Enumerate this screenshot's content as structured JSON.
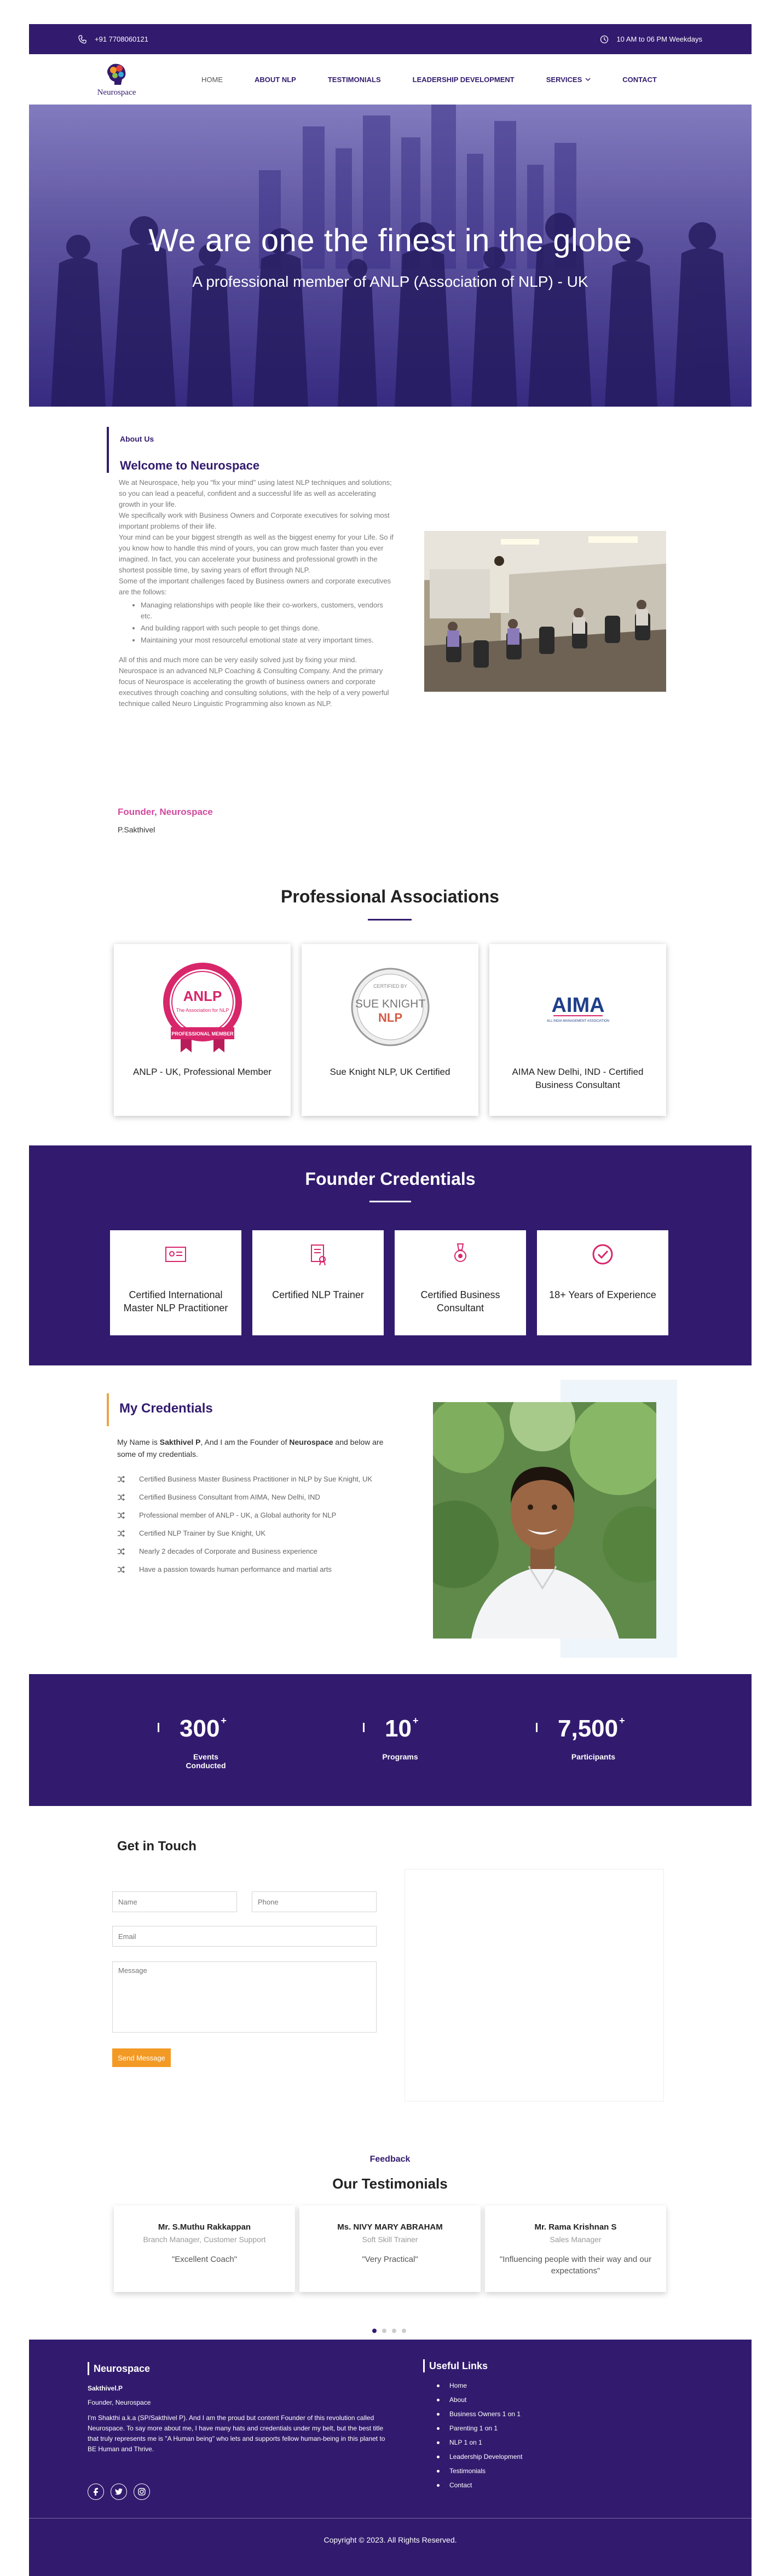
{
  "topbar": {
    "phone": "+91 7708060121",
    "hours": "10 AM to 06 PM Weekdays"
  },
  "brand": {
    "name": "Neurospace"
  },
  "nav": [
    {
      "label": "HOME"
    },
    {
      "label": "ABOUT NLP"
    },
    {
      "label": "TESTIMONIALS"
    },
    {
      "label": "LEADERSHIP DEVELOPMENT"
    },
    {
      "label": "SERVICES"
    },
    {
      "label": "CONTACT"
    }
  ],
  "hero": {
    "title": "We are one the finest in the globe",
    "subtitle": "A professional member of ANLP (Association of NLP) - UK"
  },
  "about": {
    "kicker": "About Us",
    "title": "Welcome to Neurospace",
    "p1": "We at Neurospace, help you \"fix your mind\" using latest NLP techniques and solutions; so you can lead a peaceful, confident and a successful life as well as accelerating growth in your life.",
    "p2": "We specifically work with Business Owners and Corporate executives for solving most important problems of their life.",
    "p3": "Your mind can be your biggest strength as well as the biggest enemy for your Life. So if you know how to handle this mind of yours, you can grow much faster than you ever imagined. In fact, you can accelerate your business and professional growth in the shortest possible time, by saving years of effort through NLP.",
    "p4": "Some of the important challenges faced by Business owners and corporate executives are the follows:",
    "bullets": [
      "Managing relationships with people like their co-workers, customers, vendors etc.",
      "And building rapport with such people to get things done.",
      "Maintaining your most resourceful emotional state at very important times."
    ],
    "p5": "All of this and much more can be very easily solved just by fixing your mind. Neurospace is an advanced NLP Coaching & Consulting Company. And the primary focus of Neurospace is accelerating the growth of business owners and corporate executives through coaching and consulting solutions, with the help of a very powerful technique called Neuro Linguistic Programming also known as NLP.",
    "founder_label": "Founder, Neurospace",
    "founder_name": "P.Sakthivel"
  },
  "associations": {
    "title": "Professional Associations",
    "badge_anlp": {
      "top": "ANLP",
      "mid": "The Association for NLP",
      "ribbon": "PROFESSIONAL MEMBER"
    },
    "badge_sue": {
      "line1": "SUE KNIGHT",
      "line2": "NLP",
      "ring": "CERTIFIED BY"
    },
    "badge_aima": {
      "line1": "AIMA",
      "line2": "ALL INDIA MANAGEMENT ASSOCIATION"
    },
    "cards": [
      {
        "label": "ANLP - UK, Professional Member"
      },
      {
        "label": "Sue Knight NLP, UK Certified"
      },
      {
        "label": "AIMA New Delhi, IND - Certified Business Consultant"
      }
    ]
  },
  "credentials": {
    "title": "Founder Credentials",
    "cards": [
      {
        "label": "Certified International Master NLP Practitioner",
        "icon": "certificate-icon"
      },
      {
        "label": "Certified NLP Trainer",
        "icon": "diploma-icon"
      },
      {
        "label": "Certified Business Consultant",
        "icon": "award-icon"
      },
      {
        "label": "18+ Years of Experience",
        "icon": "check-circle-icon"
      }
    ]
  },
  "my_credentials": {
    "title": "My Credentials",
    "intro_pre": "My Name is ",
    "intro_name": "Sakthivel P",
    "intro_mid": ", And I am the Founder of ",
    "intro_brand": "Neurospace",
    "intro_post": " and below are some of my credentials.",
    "items": [
      "Certified Business Master Business Practitioner in NLP by Sue Knight, UK",
      "Certified Business Consultant from AIMA, New Delhi, IND",
      "Professional member of ANLP - UK, a Global authority for NLP",
      "Certified NLP Trainer by Sue Knight, UK",
      "Nearly 2 decades of Corporate and Business experience",
      "Have a passion towards human performance and martial arts"
    ]
  },
  "stats": [
    {
      "value": "300",
      "suffix": "+",
      "label": "Events Conducted"
    },
    {
      "value": "10",
      "suffix": "+",
      "label": "Programs"
    },
    {
      "value": "7,500",
      "suffix": "+",
      "label": "Participants"
    }
  ],
  "contact": {
    "title": "Get in Touch",
    "name_ph": "Name",
    "phone_ph": "Phone",
    "email_ph": "Email",
    "message_ph": "Message",
    "send": "Send Message"
  },
  "testimonials": {
    "kicker": "Feedback",
    "title": "Our Testimonials",
    "items": [
      {
        "name": "Mr. S.Muthu Rakkappan",
        "role": "Branch Manager, Customer Support",
        "quote": "\"Excellent Coach\""
      },
      {
        "name": "Ms. NIVY MARY ABRAHAM",
        "role": "Soft Skill Trainer",
        "quote": "\"Very Practical\""
      },
      {
        "name": "Mr. Rama Krishnan S",
        "role": "Sales Manager",
        "quote": "\"Influencing people with their way and our expectations\""
      }
    ]
  },
  "footer": {
    "brand_title": "Neurospace",
    "person": "Sakthivel.P",
    "role": "Founder, Neurospace",
    "bio": "I'm Shakthi a.k.a (SP/Sakthivel P). And I am the proud but content Founder of this revolution called Neurospace. To say more about me, I have many hats and credentials under my belt, but the best title that truly represents me is \"A Human being\" who lets and supports fellow human-being in this planet to BE Human and Thrive.",
    "links_title": "Useful Links",
    "links": [
      "Home",
      "About",
      "Business Owners 1 on 1",
      "Parenting 1 on 1",
      "NLP 1 on 1",
      "Leadership Development",
      "Testimonials",
      "Contact"
    ],
    "copyright": "Copyright © 2023. All Rights Reserved."
  },
  "colors": {
    "brand": "#321b6e",
    "accent_orange": "#f39a25",
    "accent_pink": "#d14a9e"
  }
}
